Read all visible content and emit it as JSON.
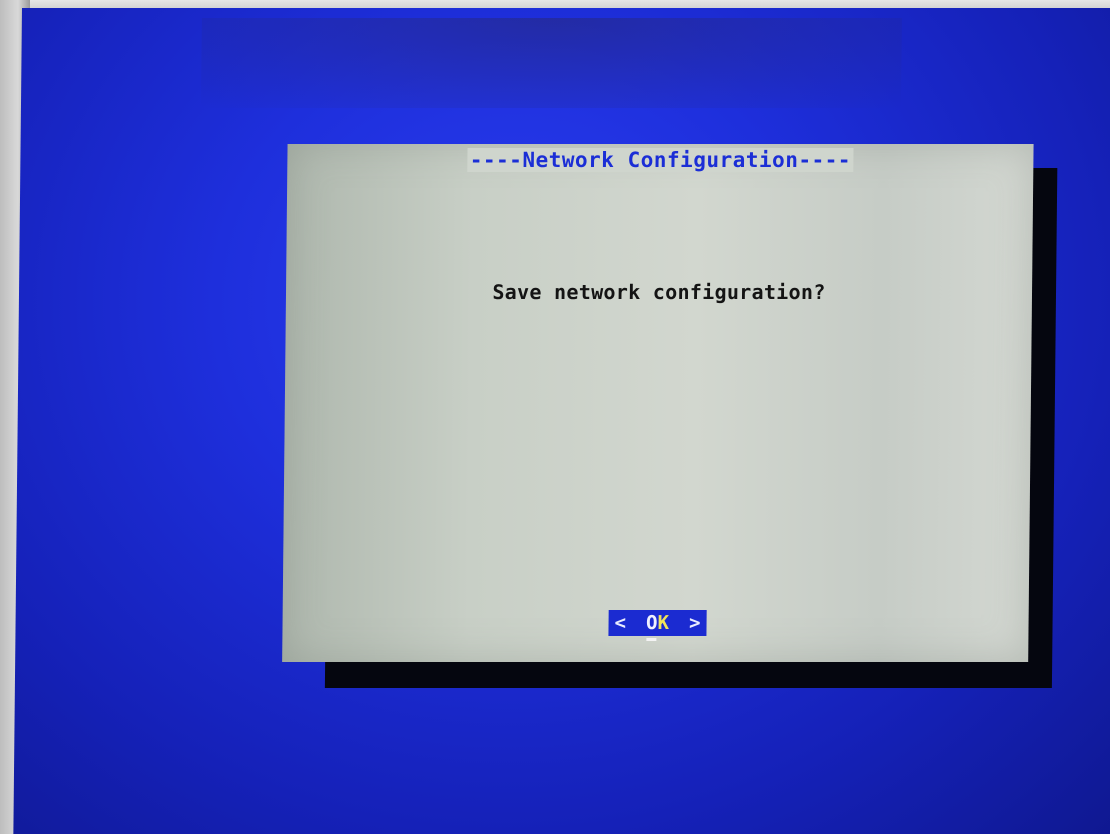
{
  "dialog": {
    "title": "----Network Configuration----",
    "message": "Save network configuration?",
    "ok_button": {
      "left_bracket": "<",
      "label_first": "O",
      "label_hotkey": "K",
      "right_bracket": ">"
    }
  },
  "colors": {
    "screen_background": "#1e2fdc",
    "dialog_background": "#cfd5cd",
    "title_text": "#1b2ed6",
    "button_background": "#1b2bd1",
    "hotkey_text": "#f2e45a"
  }
}
